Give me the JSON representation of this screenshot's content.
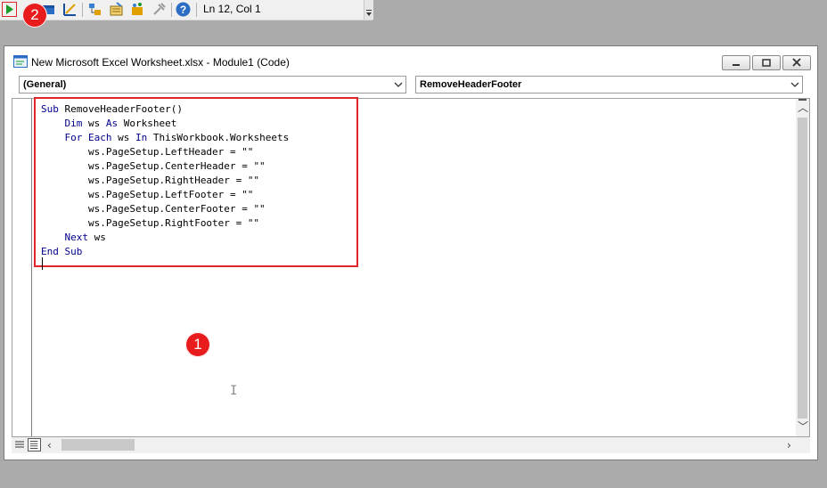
{
  "toolbar": {
    "status": "Ln 12, Col 1",
    "icons": [
      "run-icon",
      "userform-icon",
      "design-mode-icon",
      "project-explorer-icon",
      "properties-icon",
      "object-browser-icon",
      "toolbox-icon",
      "help-icon"
    ]
  },
  "annotations": {
    "badge_1": "1",
    "badge_2": "2"
  },
  "window": {
    "title": "New Microsoft Excel Worksheet.xlsx - Module1 (Code)",
    "object_combo": "(General)",
    "procedure_combo": "RemoveHeaderFooter"
  },
  "code_lines": [
    "Sub RemoveHeaderFooter()",
    "    Dim ws As Worksheet",
    "    For Each ws In ThisWorkbook.Worksheets",
    "        ws.PageSetup.LeftHeader = \"\"",
    "        ws.PageSetup.CenterHeader = \"\"",
    "        ws.PageSetup.RightHeader = \"\"",
    "        ws.PageSetup.LeftFooter = \"\"",
    "        ws.PageSetup.CenterFooter = \"\"",
    "        ws.PageSetup.RightFooter = \"\"",
    "    Next ws",
    "End Sub"
  ],
  "keywords": [
    "Sub",
    "Dim",
    "As",
    "For",
    "Each",
    "In",
    "Next",
    "End"
  ],
  "colors": {
    "keyword": "#00008b",
    "highlight": "#e0262a",
    "badge": "#e81c1c"
  }
}
